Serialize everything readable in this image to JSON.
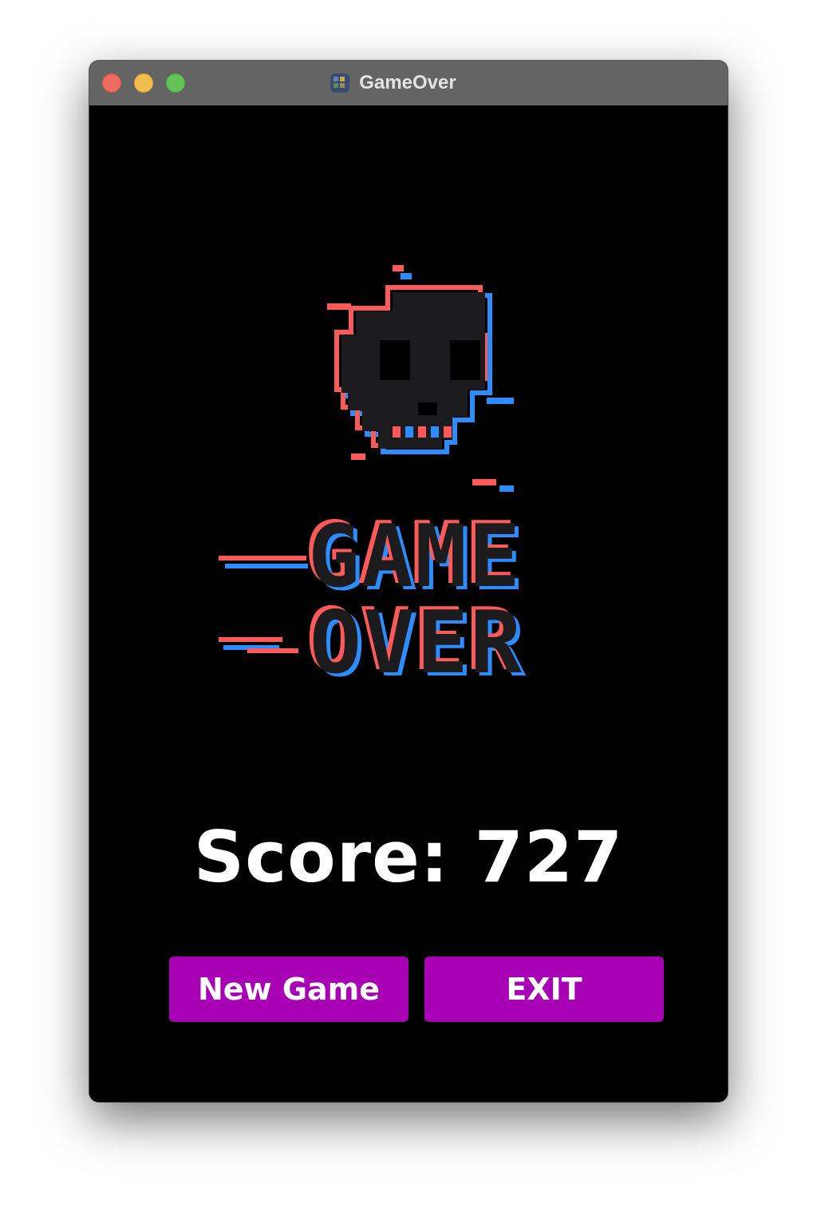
{
  "window": {
    "title": "GameOver",
    "app_icon": "game-app-icon"
  },
  "game_over": {
    "line1": "GAME",
    "line2": "OVER",
    "skull_icon": "pixel-skull-icon",
    "colors": {
      "fill": "#1c1c1e",
      "red": "#ff5a5a",
      "blue": "#2d8cff"
    }
  },
  "score": {
    "text": "Score: 727"
  },
  "buttons": {
    "new_game": "New Game",
    "exit": "EXIT",
    "color": "#a800b5"
  }
}
